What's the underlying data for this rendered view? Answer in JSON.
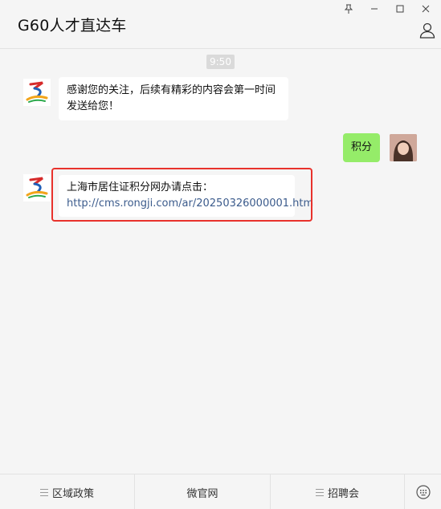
{
  "window": {
    "title": "G60人才直达车"
  },
  "chat": {
    "timestamp": "9:50",
    "messages": [
      {
        "from": "account",
        "text": "感谢您的关注，后续有精彩的内容会第一时间发送给您！"
      },
      {
        "from": "me",
        "text": "积分"
      },
      {
        "from": "account",
        "text_prefix": "上海市居住证积分网办请点击：",
        "link": "http://cms.rongji.com/ar/20250326000001.htm"
      }
    ]
  },
  "bottom_menu": {
    "items": [
      {
        "label": "区域政策"
      },
      {
        "label": "微官网"
      },
      {
        "label": "招聘会"
      }
    ]
  },
  "colors": {
    "my_bubble": "#95ec69",
    "highlight_border": "#e8322c",
    "link": "#3b5b8c"
  }
}
